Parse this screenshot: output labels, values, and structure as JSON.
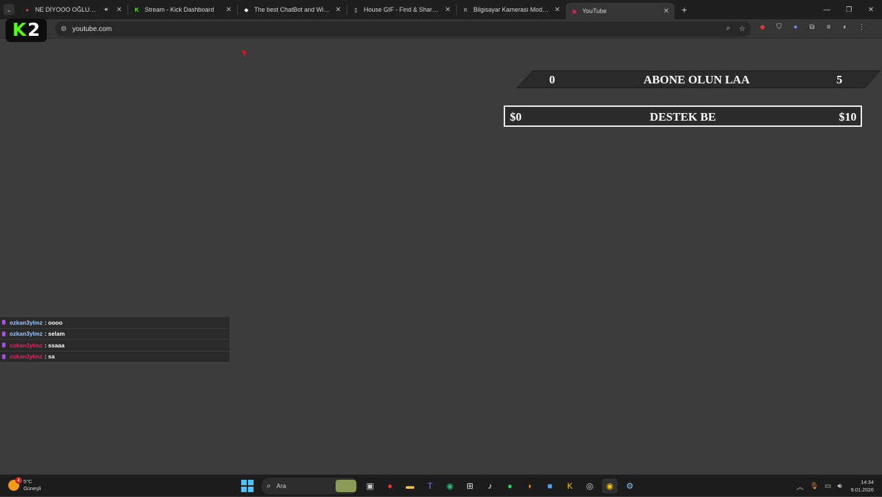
{
  "browser": {
    "tabs": [
      {
        "title": "NE DİYOOO OĞLUM - Insta",
        "icon": "instagram-icon",
        "audio": true,
        "active": false
      },
      {
        "title": "Stream - Kick Dashboard",
        "icon": "kick-icon",
        "audio": false,
        "active": false
      },
      {
        "title": "The best ChatBot and Widgets",
        "icon": "botrix-icon",
        "audio": false,
        "active": false
      },
      {
        "title": "House GIF - Find & Share on GIPHY",
        "icon": "giphy-icon",
        "audio": false,
        "active": false
      },
      {
        "title": "Bilgisayar Kamerası Modelleri | Fiyatları",
        "icon": "trendyol-icon",
        "audio": false,
        "active": false
      },
      {
        "title": "YouTube",
        "icon": "youtube-icon",
        "audio": false,
        "active": true
      }
    ],
    "url": "youtube.com"
  },
  "overlay": {
    "kick_logo": {
      "letter": "K",
      "number": "2"
    },
    "goal_subs": {
      "start": "0",
      "label": "ABONE OLUN LAA",
      "end": "5",
      "progress": 0
    },
    "goal_donation": {
      "start": "$0",
      "label": "DESTEK BE",
      "end": "$10",
      "progress": 0
    },
    "chat": [
      {
        "user": "ozkan3ylmz",
        "message": ": oooo",
        "user_color": "#9ec9ff"
      },
      {
        "user": "ozkan3ylmz",
        "message": ": selam",
        "user_color": "#9ec9ff"
      },
      {
        "user": "ozkan3ylmz",
        "message": ": ssaaa",
        "user_color": "#e0245e"
      },
      {
        "user": "ozkan3ylmz",
        "message": ": sa",
        "user_color": "#e0245e"
      }
    ]
  },
  "taskbar": {
    "weather": {
      "temp": "5°C",
      "condition": "Güneşli",
      "notifications": "4"
    },
    "search_placeholder": "Ara",
    "time": "14:34",
    "date": "9.01.2026"
  }
}
